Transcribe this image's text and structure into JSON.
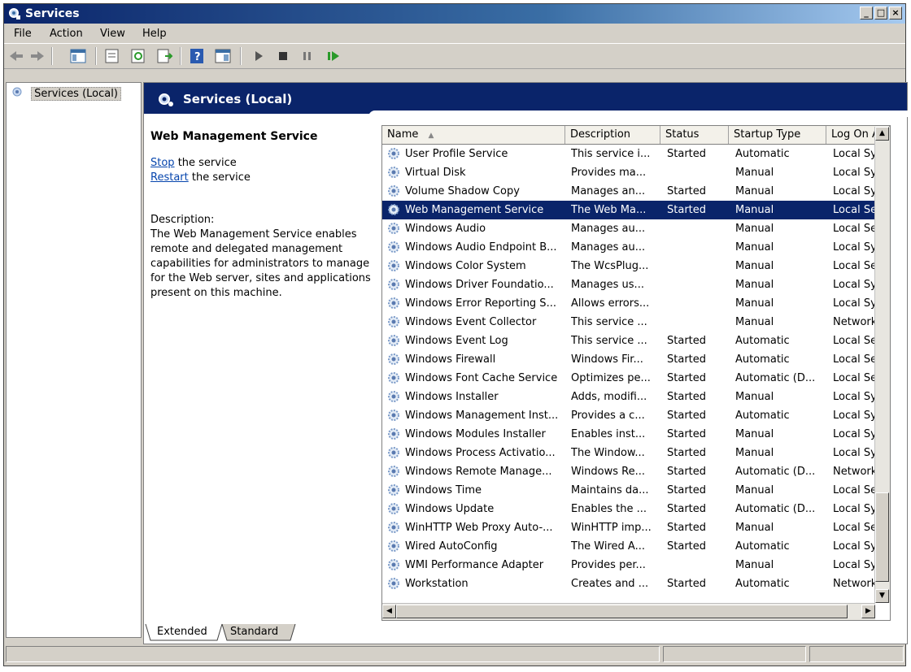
{
  "window": {
    "title": "Services"
  },
  "menu": [
    "File",
    "Action",
    "View",
    "Help"
  ],
  "tree": {
    "root_label": "Services (Local)"
  },
  "banner": {
    "title": "Services (Local)"
  },
  "detail": {
    "service_name": "Web Management Service",
    "stop_link": "Stop",
    "stop_suffix": " the service",
    "restart_link": "Restart",
    "restart_suffix": " the service",
    "description_label": "Description:",
    "description_text": "The Web Management Service enables remote and delegated management capabilities for administrators to manage for the Web server, sites and applications present on this machine."
  },
  "columns": [
    "Name",
    "Description",
    "Status",
    "Startup Type",
    "Log On As"
  ],
  "services": [
    {
      "name": "User Profile Service",
      "description": "This service i...",
      "status": "Started",
      "startup": "Automatic",
      "logon": "Local Syst"
    },
    {
      "name": "Virtual Disk",
      "description": "Provides ma...",
      "status": "",
      "startup": "Manual",
      "logon": "Local Syst"
    },
    {
      "name": "Volume Shadow Copy",
      "description": "Manages an...",
      "status": "Started",
      "startup": "Manual",
      "logon": "Local Syst"
    },
    {
      "name": "Web Management Service",
      "description": "The Web Ma...",
      "status": "Started",
      "startup": "Manual",
      "logon": "Local Serv",
      "selected": true
    },
    {
      "name": "Windows Audio",
      "description": "Manages au...",
      "status": "",
      "startup": "Manual",
      "logon": "Local Serv"
    },
    {
      "name": "Windows Audio Endpoint B...",
      "description": "Manages au...",
      "status": "",
      "startup": "Manual",
      "logon": "Local Syst"
    },
    {
      "name": "Windows Color System",
      "description": "The WcsPlug...",
      "status": "",
      "startup": "Manual",
      "logon": "Local Serv"
    },
    {
      "name": "Windows Driver Foundatio...",
      "description": "Manages us...",
      "status": "",
      "startup": "Manual",
      "logon": "Local Syst"
    },
    {
      "name": "Windows Error Reporting S...",
      "description": "Allows errors...",
      "status": "",
      "startup": "Manual",
      "logon": "Local Syst"
    },
    {
      "name": "Windows Event Collector",
      "description": "This service ...",
      "status": "",
      "startup": "Manual",
      "logon": "Network S"
    },
    {
      "name": "Windows Event Log",
      "description": "This service ...",
      "status": "Started",
      "startup": "Automatic",
      "logon": "Local Serv"
    },
    {
      "name": "Windows Firewall",
      "description": "Windows Fir...",
      "status": "Started",
      "startup": "Automatic",
      "logon": "Local Serv"
    },
    {
      "name": "Windows Font Cache Service",
      "description": "Optimizes pe...",
      "status": "Started",
      "startup": "Automatic (D...",
      "logon": "Local Serv"
    },
    {
      "name": "Windows Installer",
      "description": "Adds, modifi...",
      "status": "Started",
      "startup": "Manual",
      "logon": "Local Syst"
    },
    {
      "name": "Windows Management Inst...",
      "description": "Provides a c...",
      "status": "Started",
      "startup": "Automatic",
      "logon": "Local Syst"
    },
    {
      "name": "Windows Modules Installer",
      "description": "Enables inst...",
      "status": "Started",
      "startup": "Manual",
      "logon": "Local Syst"
    },
    {
      "name": "Windows Process Activatio...",
      "description": "The Window...",
      "status": "Started",
      "startup": "Manual",
      "logon": "Local Syst"
    },
    {
      "name": "Windows Remote Manage...",
      "description": "Windows Re...",
      "status": "Started",
      "startup": "Automatic (D...",
      "logon": "Network S"
    },
    {
      "name": "Windows Time",
      "description": "Maintains da...",
      "status": "Started",
      "startup": "Manual",
      "logon": "Local Serv"
    },
    {
      "name": "Windows Update",
      "description": "Enables the ...",
      "status": "Started",
      "startup": "Automatic (D...",
      "logon": "Local Syst"
    },
    {
      "name": "WinHTTP Web Proxy Auto-...",
      "description": "WinHTTP imp...",
      "status": "Started",
      "startup": "Manual",
      "logon": "Local Serv"
    },
    {
      "name": "Wired AutoConfig",
      "description": "The Wired A...",
      "status": "Started",
      "startup": "Automatic",
      "logon": "Local Syst"
    },
    {
      "name": "WMI Performance Adapter",
      "description": "Provides per...",
      "status": "",
      "startup": "Manual",
      "logon": "Local Syst"
    },
    {
      "name": "Workstation",
      "description": "Creates and ...",
      "status": "Started",
      "startup": "Automatic",
      "logon": "Network S"
    }
  ],
  "tabs": [
    "Extended",
    "Standard"
  ],
  "colors": {
    "selection": "#0a246a",
    "banner": "#0a246a",
    "link": "#0645ad"
  }
}
